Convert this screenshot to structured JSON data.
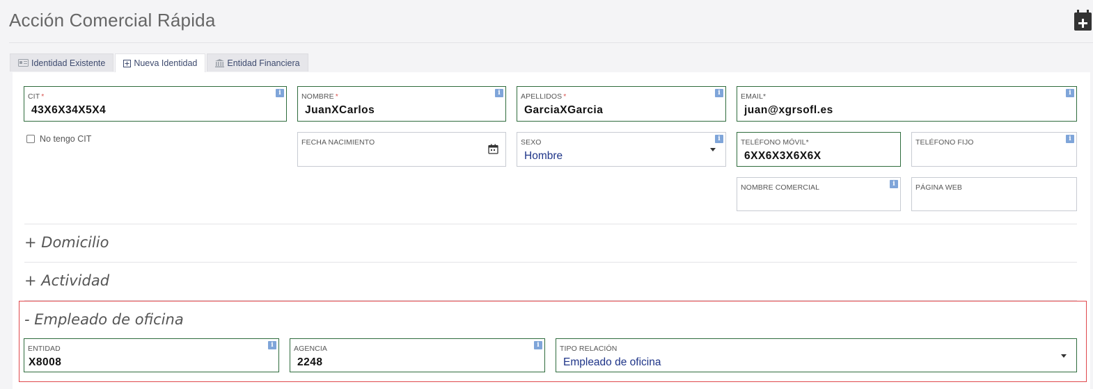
{
  "header": {
    "title": "Acción Comercial Rápida"
  },
  "tabs": [
    {
      "label": "Identidad Existente"
    },
    {
      "label": "Nueva Identidad"
    },
    {
      "label": "Entidad Financiera"
    }
  ],
  "fields": {
    "cit": {
      "label": "CIT",
      "required": "*",
      "value": "43X6X34X5X4"
    },
    "nombre": {
      "label": "NOMBRE",
      "required": "*",
      "value": "JuanXCarlos"
    },
    "apellidos": {
      "label": "APELLIDOS",
      "required": "*",
      "value": "GarciaXGarcia"
    },
    "email": {
      "label": "EMAIL*",
      "value": "juan@xgrsofl.es"
    },
    "fecha_nacimiento": {
      "label": "FECHA NACIMIENTO",
      "value": ""
    },
    "sexo": {
      "label": "SEXO",
      "value": "Hombre"
    },
    "telefono_movil": {
      "label": "TELÉFONO MÓVIL*",
      "value": "6XX6X3X6X6X"
    },
    "telefono_fijo": {
      "label": "TELÉFONO FIJO",
      "value": ""
    },
    "nombre_comercial": {
      "label": "NOMBRE COMERCIAL",
      "value": ""
    },
    "pagina_web": {
      "label": "PÁGINA WEB",
      "value": ""
    }
  },
  "no_cit_label": "No tengo CIT",
  "sections": {
    "domicilio": "+ Domicilio",
    "actividad": "+ Actividad",
    "empleado": "- Empleado de oficina"
  },
  "empleado_fields": {
    "entidad": {
      "label": "ENTIDAD",
      "value": "X8008"
    },
    "agencia": {
      "label": "AGENCIA",
      "value": "2248"
    },
    "tipo_relacion": {
      "label": "TIPO RELACIÓN",
      "value": "Empleado de oficina"
    }
  },
  "info_glyph": "i",
  "colors": {
    "filled_border": "#2e6b3c",
    "highlight": "#e0474b",
    "info": "#7fa5d9"
  }
}
